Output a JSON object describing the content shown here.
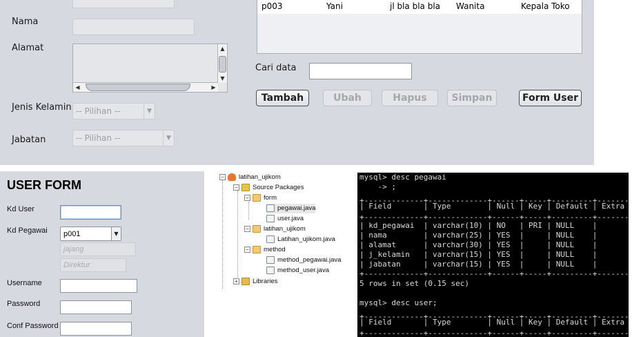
{
  "pegawai_form": {
    "labels": {
      "nama": "Nama",
      "alamat": "Alamat",
      "jenis_kelamin": "Jenis Kelamin",
      "jabatan": "Jabatan",
      "cari_data": "Cari data"
    },
    "jenis_kelamin_select": "-- Pilihan --",
    "jabatan_select": "-- Pilihan --",
    "table_row": [
      "p003",
      "Yani",
      "jl bla bla bla",
      "Wanita",
      "Kepala Toko"
    ],
    "search_value": "",
    "buttons": {
      "tambah": "Tambah",
      "ubah": "Ubah",
      "hapus": "Hapus",
      "simpan": "Simpan",
      "form_user": "Form User"
    }
  },
  "user_form": {
    "title": "USER FORM",
    "labels": {
      "kd_user": "Kd User",
      "kd_pegawai": "Kd Pegawai",
      "username": "Username",
      "password": "Password",
      "conf_password": "Conf Password"
    },
    "kd_pegawai_value": "p001",
    "nama_display": "jajang",
    "jabatan_display": "Direktur"
  },
  "project_tree": {
    "project": "latihan_ujikom",
    "source_packages": "Source Packages",
    "pkg_form": "form",
    "file_pegawai": "pegawai.java",
    "file_user": "user.java",
    "pkg_latihan": "latihan_ujikom",
    "file_latihan": "Latihan_ujikom.java",
    "pkg_method": "method",
    "file_method_pegawai": "method_pegawai.java",
    "file_method_user": "method_user.java",
    "libraries": "Libraries"
  },
  "console": {
    "lines": [
      "mysql> desc pegawai",
      "    -> ;",
      "+-------------+-------------+------+-----+---------+-------+",
      "| Field       | Type        | Null | Key | Default | Extra |",
      "+-------------+-------------+------+-----+---------+-------+",
      "| kd_pegawai  | varchar(10) | NO   | PRI | NULL    |       |",
      "| nama        | varchar(25) | YES  |     | NULL    |       |",
      "| alamat      | varchar(30) | YES  |     | NULL    |       |",
      "| j_kelamin   | varchar(15) | YES  |     | NULL    |       |",
      "| jabatan     | varchar(15) | YES  |     | NULL    |       |",
      "+-------------+-------------+------+-----+---------+-------+",
      "5 rows in set (0.15 sec)",
      "",
      "mysql> desc user;",
      "+-------------+-------------+------+-----+---------+-------+",
      "| Field       | Type        | Null | Key | Default | Extra |",
      "+-------------+-------------+------+-----+---------+-------+"
    ]
  }
}
